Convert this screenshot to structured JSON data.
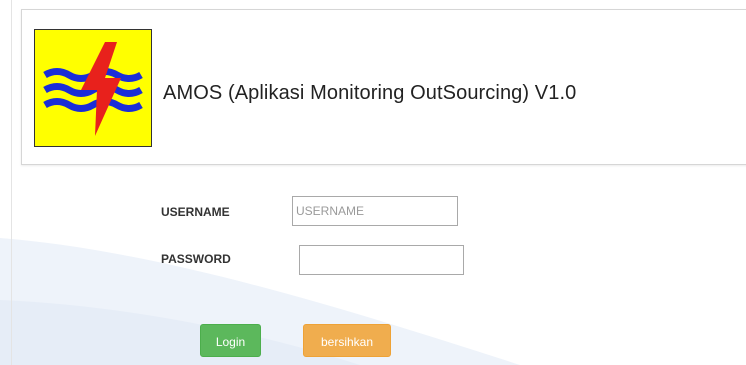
{
  "header": {
    "app_title": "AMOS (Aplikasi Monitoring OutSourcing) V1.0",
    "logo_icon": "pln-lightning-logo-icon",
    "logo_background": "#ffff00",
    "logo_waves_color": "#1a2dd8",
    "logo_bolt_color": "#e8211c"
  },
  "login_form": {
    "username_label": "USERNAME",
    "username_placeholder": "USERNAME",
    "username_value": "",
    "password_label": "PASSWORD",
    "password_placeholder": "",
    "password_value": "",
    "login_button_label": "Login",
    "clear_button_label": "bersihkan",
    "login_button_color": "#5cb85c",
    "clear_button_color": "#f0ad4e"
  }
}
